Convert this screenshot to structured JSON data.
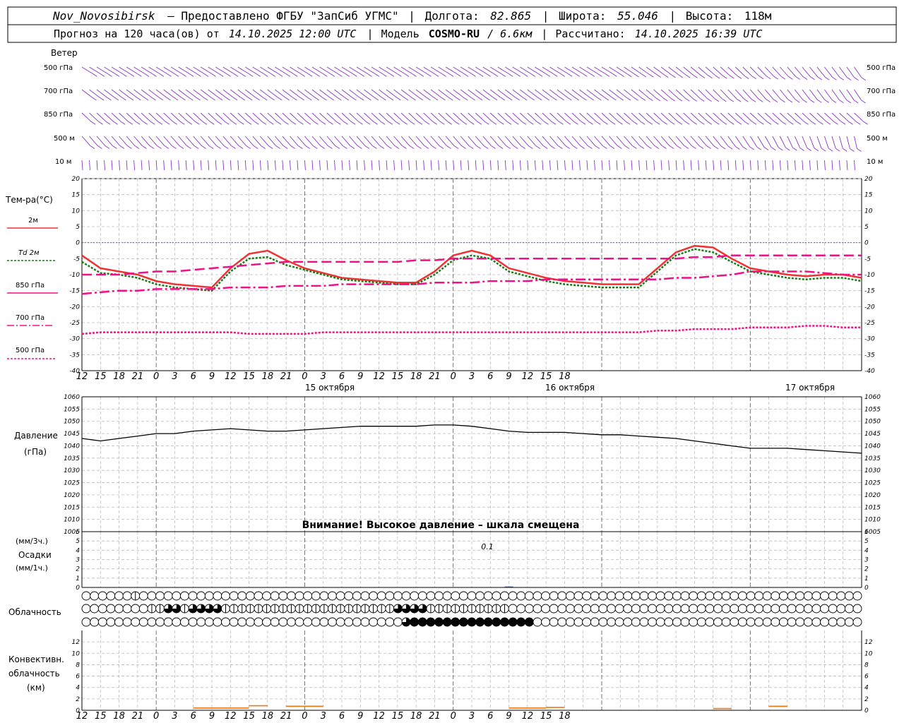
{
  "header": {
    "line1": {
      "station": "Nov_Novosibirsk",
      "provided_label": "– Предоставлено ФГБУ \"ЗапСиб УГМС\"",
      "lon_label": "Долгота:",
      "lon_value": "82.865",
      "lat_label": "Широта:",
      "lat_value": "55.046",
      "alt_label": "Высота:",
      "alt_value": "118м"
    },
    "line2": {
      "forecast_label": "Прогноз на 120 часа(ов) от",
      "forecast_start": "14.10.2025 12:00 UTC",
      "model_label": "Модель",
      "model_name": "COSMO-RU",
      "model_res": "/ 6.6км",
      "calc_label": "Рассчитано:",
      "calc_time": "14.10.2025 16:39 UTC"
    }
  },
  "chart_data": [
    {
      "type": "wind_barbs",
      "title": "Ветер",
      "levels": [
        "500 гПа",
        "700 гПа",
        "850 гПа",
        "500 м",
        "10 м"
      ]
    },
    {
      "type": "line",
      "ylabel": "Тем-ра(°C)",
      "ylim": [
        -40,
        20
      ],
      "yticks": [
        20,
        15,
        10,
        5,
        0,
        -5,
        -10,
        -15,
        -20,
        -25,
        -30,
        -35,
        -40
      ],
      "x_hours": [
        0,
        3,
        6,
        9,
        12,
        15,
        18,
        21,
        24,
        27,
        30,
        33,
        36,
        39,
        42,
        45,
        48,
        51,
        54,
        57,
        60,
        63,
        66,
        69,
        72,
        75,
        78,
        81,
        84,
        87,
        90,
        93,
        96,
        99,
        102,
        105,
        108,
        111,
        114,
        117,
        120,
        123,
        126
      ],
      "series": [
        {
          "name": "2м",
          "color": "#ee3333",
          "style": "solid",
          "values": [
            -4,
            -8,
            -9,
            -10,
            -12,
            -13,
            -13.5,
            -14,
            -8,
            -3.5,
            -2.5,
            -5.5,
            -8,
            -9.5,
            -11,
            -11.5,
            -12,
            -12.5,
            -12.5,
            -9,
            -4,
            -2.5,
            -4,
            -8,
            -9.5,
            -11,
            -12,
            -12.5,
            -13,
            -13,
            -13,
            -8,
            -3,
            -1,
            -1.5,
            -5,
            -8,
            -9,
            -10,
            -10.5,
            -10,
            -10,
            -11
          ]
        },
        {
          "name": "Td 2м",
          "color": "#1a7a1a",
          "style": "dotted",
          "values": [
            -6,
            -9.5,
            -10,
            -11,
            -13,
            -14,
            -14.5,
            -15,
            -9,
            -5,
            -4.5,
            -7,
            -8.5,
            -10,
            -11.5,
            -12,
            -12.5,
            -13,
            -13,
            -10,
            -5.5,
            -4,
            -5,
            -9,
            -10.5,
            -12,
            -13,
            -13.5,
            -14,
            -14,
            -14,
            -9,
            -4,
            -2,
            -3,
            -6,
            -9,
            -10,
            -11,
            -11.5,
            -11,
            -11,
            -12
          ]
        },
        {
          "name": "850 гПа",
          "color": "#ee1188",
          "style": "longdash",
          "values": [
            -10,
            -10,
            -10,
            -9.5,
            -9,
            -9,
            -8.5,
            -8,
            -7.5,
            -7,
            -6.5,
            -6,
            -6,
            -6,
            -6,
            -6,
            -6,
            -6,
            -5.5,
            -5.5,
            -5,
            -5,
            -5,
            -5,
            -5,
            -5,
            -5,
            -5,
            -5,
            -5,
            -5,
            -5,
            -5,
            -4.5,
            -4.5,
            -4,
            -4,
            -4,
            -4,
            -4,
            -4,
            -4,
            -4
          ]
        },
        {
          "name": "700 гПа",
          "color": "#ee1188",
          "style": "dashdot",
          "values": [
            -16,
            -15.5,
            -15,
            -15,
            -14.5,
            -14.5,
            -14.5,
            -14.5,
            -14,
            -14,
            -14,
            -13.5,
            -13.5,
            -13.5,
            -13,
            -13,
            -13,
            -13,
            -13,
            -12.5,
            -12.5,
            -12.5,
            -12,
            -12,
            -12,
            -11.5,
            -11.5,
            -11.5,
            -11.5,
            -11.5,
            -11.5,
            -11.5,
            -11,
            -11,
            -10.5,
            -10,
            -9,
            -9,
            -9,
            -9,
            -9.5,
            -10,
            -10
          ]
        },
        {
          "name": "500 гПа",
          "color": "#ee1188",
          "style": "dotted",
          "values": [
            -28.5,
            -28,
            -28,
            -28,
            -28,
            -28,
            -28,
            -28,
            -28,
            -28.5,
            -28.5,
            -28.5,
            -28.5,
            -28,
            -28,
            -28,
            -28,
            -28,
            -28,
            -28,
            -28,
            -28,
            -28,
            -28,
            -28,
            -28,
            -28,
            -28,
            -28,
            -28,
            -28,
            -27.5,
            -27.5,
            -27,
            -27,
            -27,
            -26.5,
            -26.5,
            -26.5,
            -26,
            -26,
            -26.5,
            -26.5
          ]
        }
      ]
    },
    {
      "type": "line",
      "ylabel": "Давление",
      "ylabel2": "(гПа)",
      "ylim": [
        1005,
        1060
      ],
      "yticks": [
        1060,
        1055,
        1050,
        1045,
        1040,
        1035,
        1030,
        1025,
        1020,
        1015,
        1010,
        1005
      ],
      "x_hours": [
        0,
        3,
        6,
        9,
        12,
        15,
        18,
        21,
        24,
        27,
        30,
        33,
        36,
        39,
        42,
        45,
        48,
        51,
        54,
        57,
        60,
        63,
        66,
        69,
        72,
        75,
        78,
        81,
        84,
        87,
        90,
        93,
        96,
        99,
        102,
        105,
        108,
        111,
        114,
        117,
        120,
        123,
        126
      ],
      "series": [
        {
          "name": "",
          "color": "#000000",
          "values": [
            1043,
            1042,
            1043,
            1044,
            1045,
            1045,
            1046,
            1046.5,
            1047,
            1046.5,
            1046,
            1046,
            1046.5,
            1047,
            1047.5,
            1048,
            1048,
            1048,
            1048,
            1048.5,
            1048.5,
            1048,
            1047,
            1046,
            1045.5,
            1045.5,
            1045.5,
            1045,
            1044.5,
            1044.5,
            1044,
            1043.5,
            1043,
            1042,
            1041,
            1040,
            1039,
            1039,
            1039,
            1038.5,
            1038,
            1037.5,
            1037
          ]
        }
      ],
      "note": "Внимание! Высокое давление – шкала смещена"
    },
    {
      "type": "bar",
      "ylabel_top": "(мм/3ч.)",
      "ylabel_mid": "Осадки",
      "ylabel_bot": "(мм/1ч.)",
      "ylim": [
        0,
        6
      ],
      "yticks": [
        6,
        5,
        4,
        3,
        2,
        1,
        0
      ],
      "annotation": "0.1",
      "bars": [
        {
          "hour": 69,
          "value": 0.1,
          "color": "#1a3ea0"
        }
      ]
    },
    {
      "type": "table",
      "ylabel": "Облачность",
      "note": "cover eighths per column; rows = high, middle, low cloud",
      "rows": [
        [
          0,
          0,
          0,
          0,
          0,
          0,
          4,
          0,
          0,
          0,
          0,
          0,
          0,
          0,
          0,
          0,
          0,
          0,
          0,
          0,
          0,
          0,
          0,
          0,
          0,
          0,
          0,
          0,
          0,
          0,
          0,
          0,
          0,
          0,
          0,
          0,
          0,
          0,
          0,
          0,
          0,
          0,
          0,
          0,
          0,
          0,
          0,
          0,
          0,
          0,
          0,
          0,
          0,
          0,
          0,
          0,
          0,
          0,
          0,
          0,
          0,
          0,
          0,
          0,
          0,
          0,
          0,
          0,
          0,
          0,
          0,
          0,
          0,
          0,
          0,
          0,
          0,
          0,
          0,
          0,
          0,
          0,
          0,
          0,
          0,
          0,
          0,
          0,
          0,
          0,
          0,
          0,
          0,
          0,
          0
        ],
        [
          0,
          0,
          0,
          0,
          0,
          0,
          0,
          0,
          4,
          4,
          5,
          6,
          4,
          5,
          6,
          5,
          6,
          4,
          4,
          4,
          4,
          4,
          4,
          4,
          4,
          4,
          4,
          4,
          4,
          4,
          4,
          4,
          4,
          4,
          4,
          4,
          4,
          4,
          5,
          5,
          6,
          5,
          4,
          4,
          4,
          4,
          4,
          4,
          4,
          4,
          4,
          4,
          0,
          0,
          0,
          0,
          0,
          0,
          0,
          0,
          0,
          0,
          0,
          0,
          0,
          0,
          0,
          0,
          0,
          0,
          0,
          0,
          0,
          0,
          0,
          0,
          0,
          0,
          0,
          0,
          0,
          0,
          0,
          0,
          0,
          0,
          0,
          0,
          0,
          0,
          0,
          0,
          0,
          0,
          0
        ],
        [
          0,
          0,
          0,
          0,
          0,
          0,
          0,
          0,
          0,
          0,
          0,
          0,
          0,
          0,
          0,
          0,
          0,
          0,
          0,
          0,
          0,
          0,
          0,
          0,
          0,
          0,
          0,
          0,
          0,
          0,
          0,
          0,
          0,
          0,
          0,
          0,
          0,
          0,
          0,
          5,
          8,
          8,
          8,
          8,
          8,
          8,
          8,
          8,
          8,
          8,
          8,
          8,
          8,
          8,
          8,
          0,
          0,
          0,
          0,
          0,
          0,
          0,
          0,
          0,
          0,
          0,
          0,
          0,
          0,
          0,
          0,
          0,
          0,
          0,
          0,
          0,
          0,
          0,
          0,
          0,
          0,
          0,
          0,
          0,
          0,
          0,
          0,
          0,
          0,
          0,
          0,
          0,
          0,
          0,
          0
        ]
      ]
    },
    {
      "type": "bar",
      "ylabel_1": "Конвективн.",
      "ylabel_2": "облачность",
      "ylabel_3": "(км)",
      "ylim": [
        0,
        14
      ],
      "yticks": [
        12,
        10,
        8,
        6,
        4,
        2,
        0
      ],
      "color": "#ee7711",
      "segments": [
        [
          18,
          27,
          0.4
        ],
        [
          27,
          30,
          0.8
        ],
        [
          33,
          39,
          0.7
        ],
        [
          69,
          75,
          0.4
        ],
        [
          75,
          78,
          0.5
        ],
        [
          102,
          105,
          0.3
        ],
        [
          111,
          114,
          0.7
        ]
      ]
    }
  ],
  "time_axis": {
    "hour_labels": [
      "12",
      "15",
      "18",
      "21",
      "0",
      "3",
      "6",
      "9",
      "12",
      "15",
      "18",
      "21",
      "0",
      "3",
      "6",
      "9",
      "12",
      "15",
      "18",
      "21",
      "0",
      "3",
      "6",
      "9",
      "12",
      "15",
      "18"
    ],
    "days": [
      "15 октября",
      "16 октября",
      "17 октября"
    ]
  }
}
